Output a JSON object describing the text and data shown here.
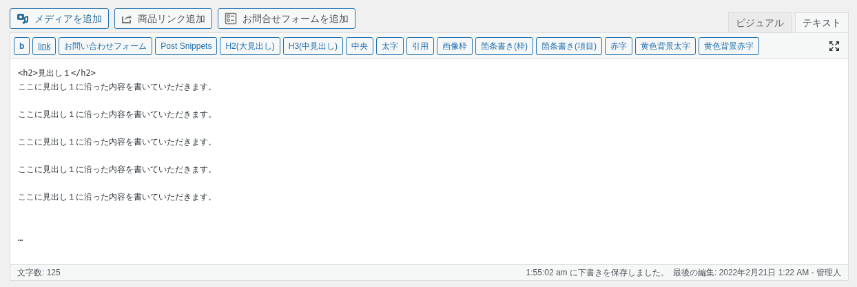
{
  "media_buttons": [
    {
      "kind": "media",
      "label": "メディアを追加"
    },
    {
      "kind": "share",
      "label": "商品リンク追加"
    },
    {
      "kind": "form",
      "label": "お問合せフォームを追加"
    }
  ],
  "tabs": [
    {
      "label": "ビジュアル",
      "selected": false
    },
    {
      "label": "テキスト",
      "selected": true
    }
  ],
  "quicktags": [
    {
      "kind": "bold",
      "label": "b"
    },
    {
      "kind": "link",
      "label": "link"
    },
    {
      "kind": "plain",
      "label": "お問い合わせフォーム"
    },
    {
      "kind": "plain",
      "label": "Post Snippets"
    },
    {
      "kind": "plain",
      "label": "H2(大見出し)"
    },
    {
      "kind": "plain",
      "label": "H3(中見出し)"
    },
    {
      "kind": "plain",
      "label": "中央"
    },
    {
      "kind": "plain",
      "label": "太字"
    },
    {
      "kind": "plain",
      "label": "引用"
    },
    {
      "kind": "plain",
      "label": "画像枠"
    },
    {
      "kind": "plain",
      "label": "箇条書き(枠)"
    },
    {
      "kind": "plain",
      "label": "箇条書き(項目)"
    },
    {
      "kind": "plain",
      "label": "赤字"
    },
    {
      "kind": "plain",
      "label": "黄色背景太字"
    },
    {
      "kind": "plain",
      "label": "黄色背景赤字"
    }
  ],
  "editor_blocks": [
    {
      "kind": "heading",
      "lines": [
        "<h2>見出し１</h2>",
        "ここに見出し１に沿った内容を書いていただきます。"
      ]
    },
    {
      "kind": "paragraph",
      "lines": [
        "ここに見出し１に沿った内容を書いていただきます。"
      ]
    },
    {
      "kind": "paragraph",
      "lines": [
        "ここに見出し１に沿った内容を書いていただきます。"
      ]
    },
    {
      "kind": "paragraph",
      "lines": [
        "ここに見出し１に沿った内容を書いていただきます。"
      ]
    },
    {
      "kind": "paragraph",
      "lines": [
        "ここに見出し１に沿った内容を書いていただきます。"
      ]
    },
    {
      "kind": "trailing",
      "lines": [
        "…"
      ]
    }
  ],
  "status_bar": {
    "word_count": "文字数: 125",
    "autosave": "1:55:02 am に下書きを保存しました。",
    "last_edit": "最後の編集: 2022年2月21日 1:22 AM - 管理人"
  }
}
